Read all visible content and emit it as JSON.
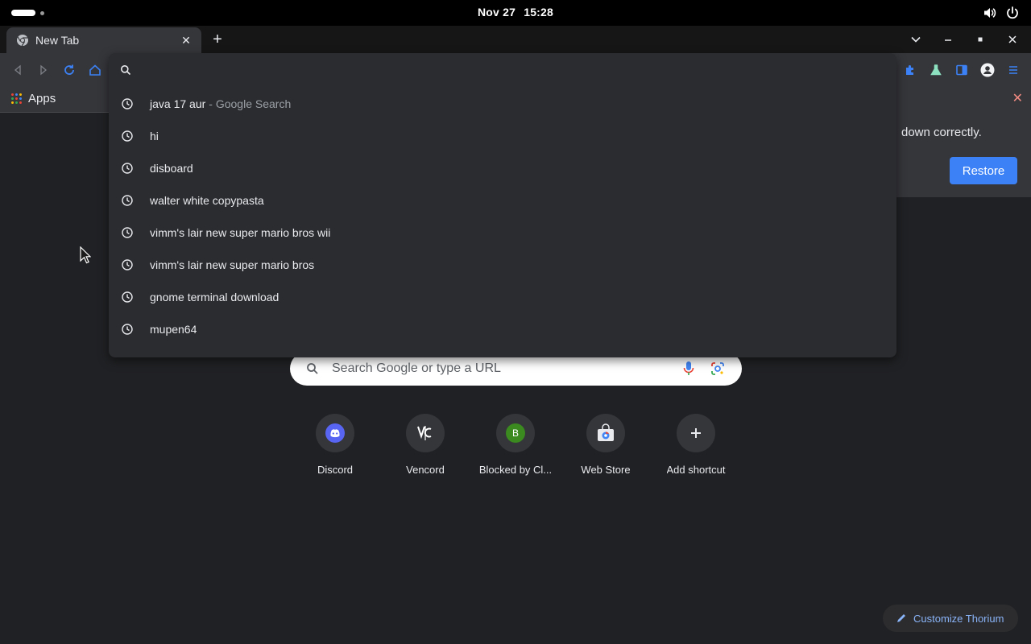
{
  "topbar": {
    "date": "Nov 27",
    "time": "15:28",
    "icons": [
      "volume-icon",
      "power-icon"
    ]
  },
  "tab": {
    "title": "New Tab",
    "close": "✕",
    "new_tab": "+"
  },
  "window_controls": {
    "dropdown": "⌄",
    "minimize": "–",
    "maximize": "▪",
    "close": "✕"
  },
  "bookmarks": {
    "apps_label": "Apps"
  },
  "omnibox": {
    "value": "",
    "suggestions": [
      {
        "text": "java 17 aur",
        "suffix": "- Google Search"
      },
      {
        "text": "hi",
        "suffix": ""
      },
      {
        "text": "disboard",
        "suffix": ""
      },
      {
        "text": "walter white copypasta",
        "suffix": ""
      },
      {
        "text": "vimm's lair new super mario bros wii",
        "suffix": ""
      },
      {
        "text": "vimm's lair new super mario bros",
        "suffix": ""
      },
      {
        "text": "gnome terminal download",
        "suffix": ""
      },
      {
        "text": "mupen64",
        "suffix": ""
      }
    ]
  },
  "restore_bar": {
    "message": "down correctly.",
    "button": "Restore",
    "close": "✕"
  },
  "ntp": {
    "search_placeholder": "Search Google or type a URL",
    "shortcuts": [
      {
        "label": "Discord",
        "icon": "discord-icon"
      },
      {
        "label": "Vencord",
        "icon": "vencord-icon"
      },
      {
        "label": "Blocked by Cl...",
        "icon": "letter-b-icon",
        "letter": "B"
      },
      {
        "label": "Web Store",
        "icon": "web-store-icon"
      },
      {
        "label": "Add shortcut",
        "icon": "plus-icon"
      }
    ],
    "customize_label": "Customize Thorium"
  },
  "colors": {
    "accent_blue": "#3c82f6",
    "link_blue": "#8ab4f8",
    "discord": "#5865f2",
    "letter_b_bg": "#3a8a1f"
  }
}
